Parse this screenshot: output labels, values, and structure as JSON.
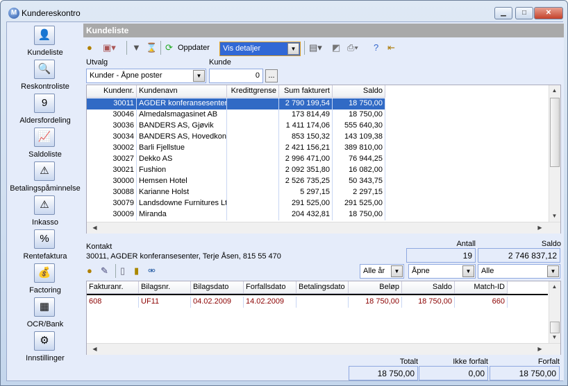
{
  "window": {
    "title": "Kundereskontro",
    "app_icon": "M",
    "buttons": {
      "minimize": "▁",
      "maximize": "□",
      "close": "✕"
    }
  },
  "sidebar": {
    "items": [
      {
        "label": "Kundeliste",
        "icon": "customer-card-icon",
        "glyph": "👤"
      },
      {
        "label": "Reskontroliste",
        "icon": "magnifier-list-icon",
        "glyph": "🔍"
      },
      {
        "label": "Aldersfordeling",
        "icon": "calendar-icon",
        "glyph": "9"
      },
      {
        "label": "Saldoliste",
        "icon": "chart-list-icon",
        "glyph": "📈"
      },
      {
        "label": "Betalingspåminnelse",
        "icon": "warning-icon",
        "glyph": "⚠"
      },
      {
        "label": "Inkasso",
        "icon": "alert-red-icon",
        "glyph": "⚠"
      },
      {
        "label": "Rentefaktura",
        "icon": "percent-icon",
        "glyph": "%"
      },
      {
        "label": "Factoring",
        "icon": "coins-icon",
        "glyph": "💰"
      },
      {
        "label": "OCR/Bank",
        "icon": "ocr-bank-icon",
        "glyph": "▦"
      },
      {
        "label": "Innstillinger",
        "icon": "settings-icon",
        "glyph": "⚙"
      }
    ]
  },
  "main": {
    "header": "Kundeliste",
    "toolbar": {
      "refresh_label": "Oppdater",
      "view_select": "Vis detaljer"
    },
    "filter": {
      "utvalg_label": "Utvalg",
      "utvalg_value": "Kunder - Åpne poster",
      "kunde_label": "Kunde",
      "kunde_value": "0",
      "browse_label": "..."
    },
    "customers": {
      "columns": [
        "Kundenr.",
        "Kundenavn",
        "Kredittgrense",
        "Sum fakturert",
        "Saldo"
      ],
      "rows": [
        [
          "30011",
          "AGDER konferansesenter",
          "",
          "2 790 199,54",
          "18 750,00"
        ],
        [
          "30046",
          "Almedalsmagasinet AB",
          "",
          "173 814,49",
          "18 750,00"
        ],
        [
          "30036",
          "BANDERS AS, Gjøvik",
          "",
          "1 411 174,06",
          "555 640,30"
        ],
        [
          "30034",
          "BANDERS AS, Hovedkontor",
          "",
          "853 150,32",
          "143 109,38"
        ],
        [
          "30002",
          "Barli Fjellstue",
          "",
          "2 421 156,21",
          "389 810,00"
        ],
        [
          "30027",
          "Dekko AS",
          "",
          "2 996 471,00",
          "76 944,25"
        ],
        [
          "30021",
          "Fushion",
          "",
          "2 092 351,80",
          "16 082,00"
        ],
        [
          "30000",
          "Hemsen Hotel",
          "",
          "2 526 735,25",
          "50 343,75"
        ],
        [
          "30088",
          "Karianne Holst",
          "",
          "5 297,15",
          "2 297,15"
        ],
        [
          "30079",
          "Landsdowne Furnitures Ltd",
          "",
          "291 525,00",
          "291 525,00"
        ],
        [
          "30009",
          "Miranda",
          "",
          "204 432,81",
          "18 750,00"
        ]
      ],
      "selected_index": 0
    },
    "contact": {
      "label": "Kontakt",
      "value": "30011, AGDER konferansesenter, Terje Åsen, 815 55 470"
    },
    "summary": {
      "antall_label": "Antall",
      "antall_value": "19",
      "saldo_label": "Saldo",
      "saldo_value": "2 746 837,12"
    },
    "entry_filters": {
      "year": "Alle år",
      "status": "Åpne",
      "type": "Alle"
    },
    "entries": {
      "columns": [
        "Fakturanr.",
        "Bilagsnr.",
        "Bilagsdato",
        "Forfallsdato",
        "Betalingsdato",
        "Beløp",
        "Saldo",
        "Match-ID"
      ],
      "rows": [
        [
          "608",
          "UF11",
          "04.02.2009",
          "14.02.2009",
          "",
          "18 750,00",
          "18 750,00",
          "660"
        ]
      ],
      "row_color": "#8b0000"
    },
    "totals": {
      "totalt_label": "Totalt",
      "totalt_value": "18 750,00",
      "ikke_forfalt_label": "Ikke forfalt",
      "ikke_forfalt_value": "0,00",
      "forfalt_label": "Forfalt",
      "forfalt_value": "18 750,00"
    }
  }
}
